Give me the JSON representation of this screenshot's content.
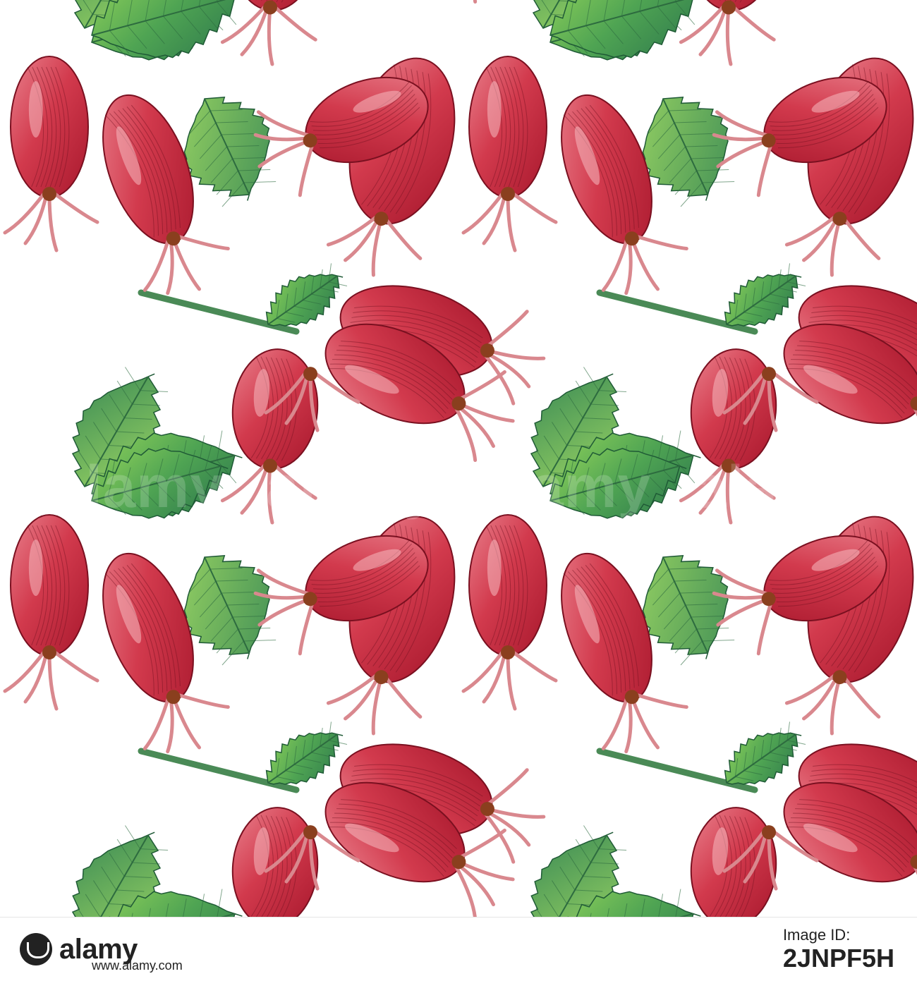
{
  "artwork": {
    "description_name": "rosehip-pattern",
    "colors": {
      "background": "#ffffff",
      "berry_dark": "#b81c32",
      "berry_mid": "#d23a4d",
      "berry_light": "#e9808c",
      "sepal": "#d9888e",
      "husk": "#8a3f1e",
      "leaf_dark": "#2f7a4c",
      "leaf_mid": "#4fa453",
      "leaf_light": "#8ccf5a",
      "stem": "#4a8a56"
    }
  },
  "watermark": {
    "words": [
      "alamy",
      "alamy",
      "alamy",
      "alamy"
    ]
  },
  "footer": {
    "brand": "alamy",
    "image_id_label": "Image ID:",
    "image_id": "2JNPF5H",
    "site": "www.alamy.com"
  }
}
